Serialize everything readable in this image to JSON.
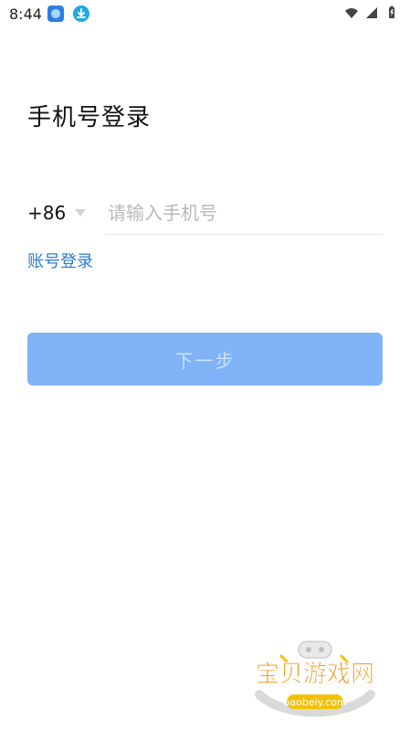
{
  "status_bar": {
    "time": "8:44"
  },
  "login": {
    "title": "手机号登录",
    "country_code": "+86",
    "phone_placeholder": "请输入手机号",
    "account_login_label": "账号登录",
    "next_label": "下一步"
  },
  "watermark": {
    "brand_cn": "宝贝游戏网",
    "domain": "baobeiy.com"
  },
  "colors": {
    "accent_link": "#2b7ccf",
    "button_bg": "#7fb2f7",
    "button_text": "#cfe1ff"
  }
}
